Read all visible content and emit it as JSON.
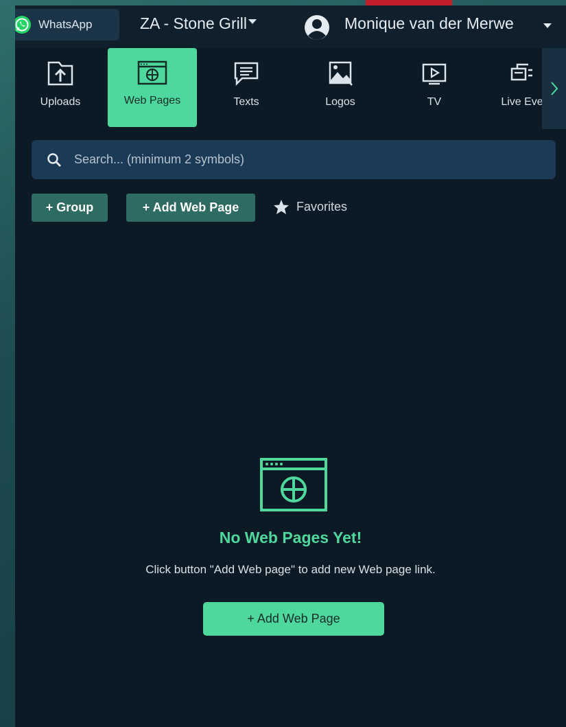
{
  "header": {
    "whatsapp_label": "WhatsApp",
    "store_name": "ZA - Stone Grill",
    "user_name": "Monique van der Merwe"
  },
  "tabs": [
    {
      "label": "Uploads",
      "icon": "upload-icon",
      "active": false
    },
    {
      "label": "Web Pages",
      "icon": "web-page-icon",
      "active": true
    },
    {
      "label": "Texts",
      "icon": "text-icon",
      "active": false
    },
    {
      "label": "Logos",
      "icon": "image-icon",
      "active": false
    },
    {
      "label": "TV",
      "icon": "tv-icon",
      "active": false
    },
    {
      "label": "Live Eve",
      "icon": "live-event-icon",
      "active": false
    }
  ],
  "search": {
    "placeholder": "Search... (minimum 2 symbols)"
  },
  "actions": {
    "group_label": "+ Group",
    "add_web_page_label": "+ Add Web Page",
    "favorites_label": "Favorites"
  },
  "empty_state": {
    "title": "No Web Pages Yet!",
    "description": "Click button \"Add Web page\" to add new Web page link.",
    "button_label": "+ Add Web Page"
  },
  "colors": {
    "accent": "#4fd89e",
    "panel_bg": "#0b1a24",
    "button_dark": "#2d6b63",
    "search_bg": "#1b3a55",
    "red_strip": "#c21f2b"
  }
}
